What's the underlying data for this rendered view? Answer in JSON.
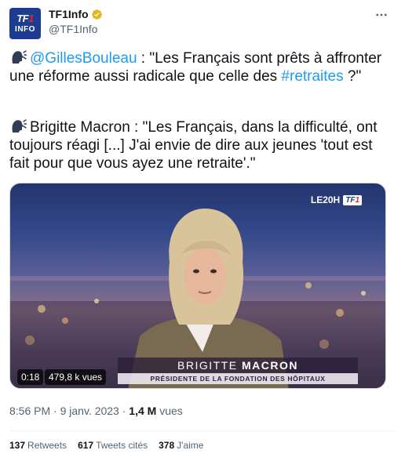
{
  "author": {
    "avatar_line1_a": "TF",
    "avatar_line1_b": "1",
    "avatar_line2": "INFO",
    "display_name": "TF1Info",
    "handle": "@TF1Info",
    "verified_icon": "verified-gold-badge-icon"
  },
  "tweet": {
    "p1_mention": "@GillesBouleau",
    "p1_text_a": " : \"Les Français sont prêts à affronter une réforme aussi radicale que celle des ",
    "p1_hashtag": "#retraites",
    "p1_text_b": " ?\"",
    "p2_text": "Brigitte Macron : \"Les Français, dans la difficulté, ont toujours réagi [...] J'ai envie de dire aux jeunes 'tout est fait pour que vous ayez une retraite'.\"",
    "emoji_icon": "speaking-head-icon"
  },
  "video": {
    "channel": "LE20H",
    "channel_logo_a": "TF",
    "channel_logo_b": "1",
    "lower_third_first": "BRIGITTE",
    "lower_third_last": "MACRON",
    "lower_third_sub": "PRÉSIDENTE DE LA FONDATION DES HÔPITAUX",
    "duration": "0:18",
    "views": "479,8 k vues"
  },
  "meta": {
    "time": "8:56 PM",
    "sep1": " · ",
    "date": "9 janv. 2023",
    "sep2": " · ",
    "views_count": "1,4 M",
    "views_label": " vues"
  },
  "stats": {
    "retweets_num": "137",
    "retweets_label": "Retweets",
    "quotes_num": "617",
    "quotes_label": "Tweets cités",
    "likes_num": "378",
    "likes_label": "J'aime"
  },
  "colors": {
    "link": "#1d9bf0",
    "text": "#0f1419",
    "secondary": "#536471",
    "verified": "#e2b719"
  }
}
